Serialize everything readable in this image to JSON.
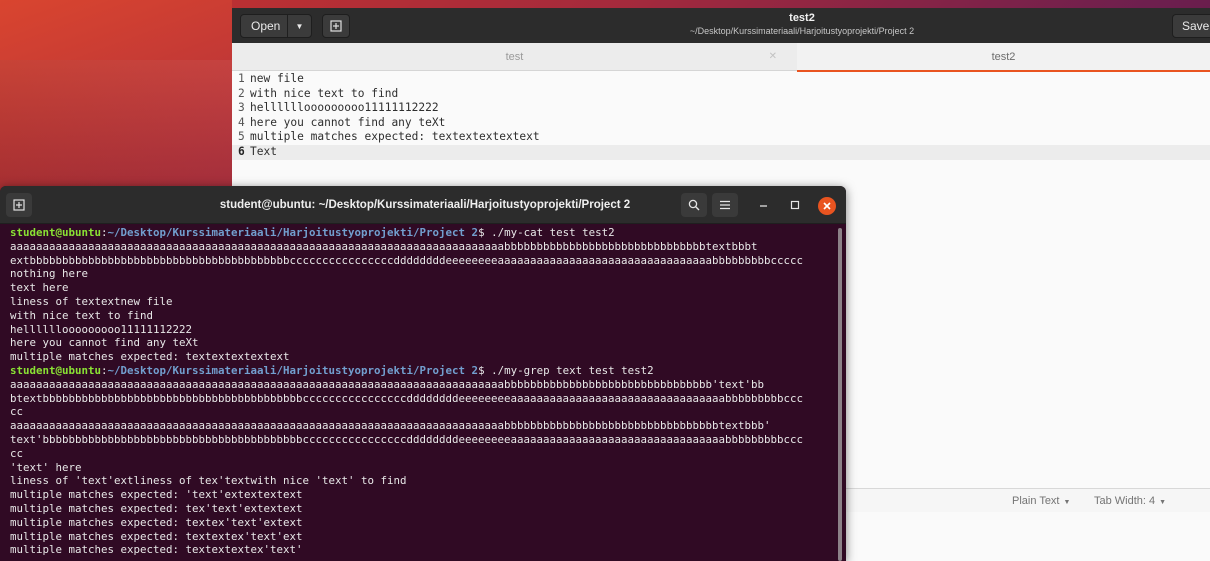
{
  "gedit": {
    "open_label": "Open",
    "title": "test2",
    "subtitle": "~/Desktop/Kurssimateriaali/Harjoitustyoprojekti/Project 2",
    "save_label": "Save",
    "tabs": [
      {
        "label": "test"
      },
      {
        "label": "test2"
      }
    ],
    "lines": [
      {
        "num": "1",
        "text": "new file"
      },
      {
        "num": "2",
        "text": "with nice text to find"
      },
      {
        "num": "3",
        "text": "hellllllooooooooo11111112222"
      },
      {
        "num": "4",
        "text": "here you cannot find any teXt"
      },
      {
        "num": "5",
        "text": "multiple matches expected: textextextextext"
      },
      {
        "num": "6",
        "text": "Text"
      }
    ],
    "status": {
      "language": "Plain Text",
      "tab_width": "Tab Width: 4"
    }
  },
  "terminal": {
    "title": "student@ubuntu: ~/Desktop/Kurssimateriaali/Harjoitustyoprojekti/Project 2",
    "prompt_user": "student@ubuntu",
    "prompt_path": "~/Desktop/Kurssimateriaali/Harjoitustyoprojekti/Project 2",
    "cmd1": "$ ./my-cat test test2",
    "cmd2": "$ ./my-grep text test test2",
    "output1": [
      "aaaaaaaaaaaaaaaaaaaaaaaaaaaaaaaaaaaaaaaaaaaaaaaaaaaaaaaaaaaaaaaaaaaaaaaaaaaabbbbbbbbbbbbbbbbbbbbbbbbbbbbbbbtextbbbt",
      "extbbbbbbbbbbbbbbbbbbbbbbbbbbbbbbbbbbbbbbbbccccccccccccccccddddddddeeeeeeeeaaaaaaaaaaaaaaaaaaaaaaaaaaaaaaaaabbbbbbbbbccccc",
      "nothing here",
      "text here",
      "liness of textextnew file",
      "with nice text to find",
      "hellllllooooooooo11111112222",
      "here you cannot find any teXt",
      "multiple matches expected: textextextextext"
    ],
    "output2": [
      "aaaaaaaaaaaaaaaaaaaaaaaaaaaaaaaaaaaaaaaaaaaaaaaaaaaaaaaaaaaaaaaaaaaaaaaaaaaabbbbbbbbbbbbbbbbbbbbbbbbbbbbbbbb'text'bb",
      "btextbbbbbbbbbbbbbbbbbbbbbbbbbbbbbbbbbbbbbbbbccccccccccccccccddddddddeeeeeeeeaaaaaaaaaaaaaaaaaaaaaaaaaaaaaaaaabbbbbbbbbccc",
      "cc",
      "aaaaaaaaaaaaaaaaaaaaaaaaaaaaaaaaaaaaaaaaaaaaaaaaaaaaaaaaaaaaaaaaaaaaaaaaaaaabbbbbbbbbbbbbbbbbbbbbbbbbbbbbbbbbtextbbb'",
      "text'bbbbbbbbbbbbbbbbbbbbbbbbbbbbbbbbbbbbbbbbccccccccccccccccddddddddeeeeeeeeaaaaaaaaaaaaaaaaaaaaaaaaaaaaaaaaabbbbbbbbbccc",
      "cc",
      "'text' here",
      "liness of 'text'extliness of tex'textwith nice 'text' to find",
      "multiple matches expected: 'text'extextextext",
      "multiple matches expected: tex'text'extextext",
      "multiple matches expected: textex'text'extext",
      "multiple matches expected: textextex'text'ext",
      "multiple matches expected: textextextex'text'"
    ]
  }
}
